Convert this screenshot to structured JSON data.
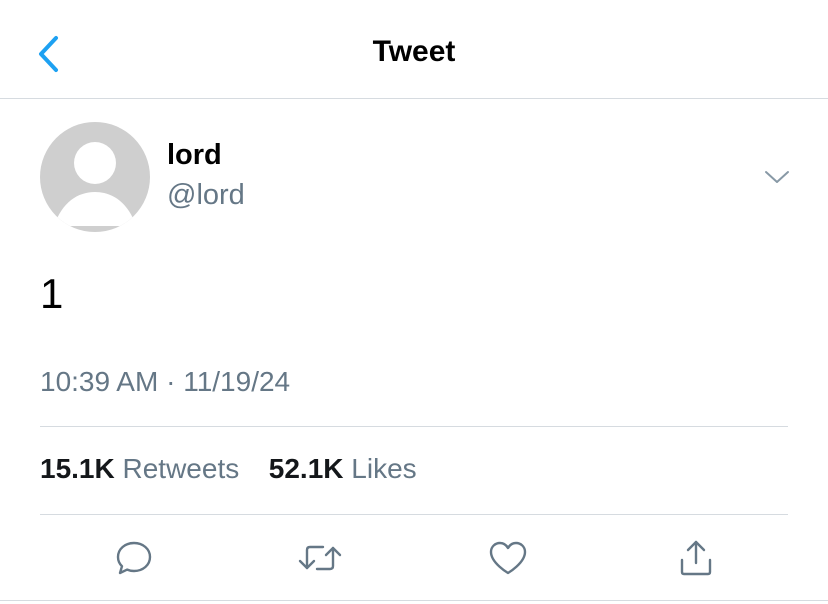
{
  "header": {
    "title": "Tweet",
    "back_icon": "chevron-left-icon"
  },
  "tweet": {
    "author_name": "lord",
    "author_handle": "@lord",
    "text": "1",
    "time": "10:39 AM",
    "separator": "·",
    "date": "11/19/24",
    "retweet_count": "15.1K",
    "retweet_label": "Retweets",
    "like_count": "52.1K",
    "like_label": "Likes"
  },
  "actions": [
    {
      "name": "reply",
      "icon": "comment-icon"
    },
    {
      "name": "retweet",
      "icon": "retweet-icon"
    },
    {
      "name": "like",
      "icon": "heart-icon"
    },
    {
      "name": "share",
      "icon": "share-icon"
    }
  ],
  "colors": {
    "accent": "#1da1f2",
    "secondary_text": "#657786",
    "divider": "#d6dbe0",
    "avatar_bg": "#cfcfcf"
  }
}
